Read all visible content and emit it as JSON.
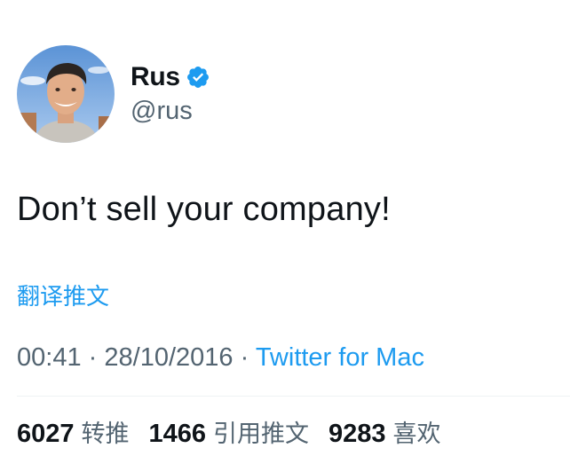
{
  "author": {
    "display_name": "Rus",
    "handle": "@rus",
    "verified": true,
    "verified_color": "#1d9bf0"
  },
  "tweet": {
    "text": "Don’t sell your company!",
    "translate_label": "翻译推文",
    "time": "00:41",
    "separator": "·",
    "date": "28/10/2016",
    "source": "Twitter for Mac"
  },
  "stats": [
    {
      "count": "6027",
      "label": "转推"
    },
    {
      "count": "1466",
      "label": "引用推文"
    },
    {
      "count": "9283",
      "label": "喜欢"
    }
  ],
  "colors": {
    "accent": "#1d9bf0",
    "text": "#0f1419",
    "secondary": "#536471",
    "divider": "#eff3f4"
  }
}
